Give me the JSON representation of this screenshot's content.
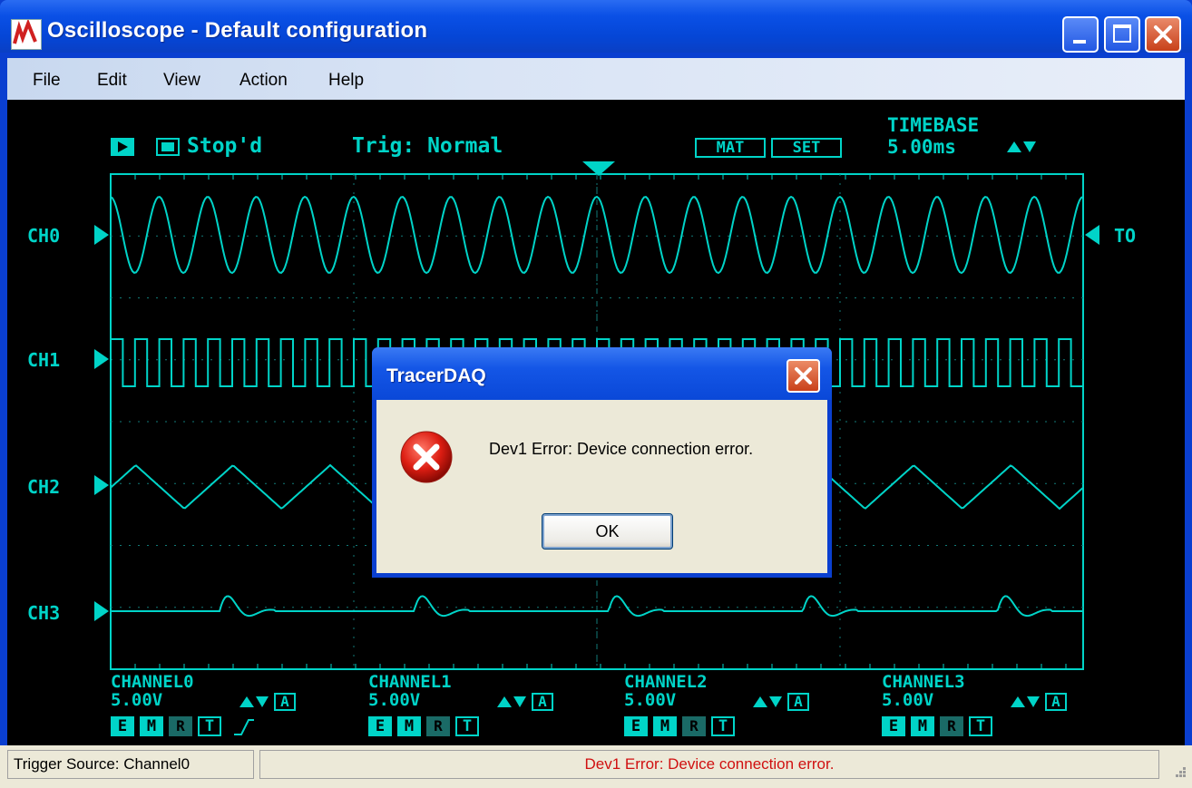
{
  "window": {
    "title": "Oscilloscope - Default configuration"
  },
  "menu": [
    "File",
    "Edit",
    "View",
    "Action",
    "Help"
  ],
  "scope": {
    "status": "Stop'd",
    "trigger": "Trig: Normal",
    "mat_label": "MAT",
    "set_label": "SET",
    "timebase_label": "TIMEBASE",
    "timebase_value": "5.00ms",
    "trigger_marker": "TO",
    "channel_markers": [
      "CH0",
      "CH1",
      "CH2",
      "CH3"
    ],
    "channels": [
      {
        "name": "CHANNEL0",
        "volts": "5.00V",
        "auto": "A",
        "flags": [
          "E",
          "M",
          "R",
          "T"
        ]
      },
      {
        "name": "CHANNEL1",
        "volts": "5.00V",
        "auto": "A",
        "flags": [
          "E",
          "M",
          "R",
          "T"
        ]
      },
      {
        "name": "CHANNEL2",
        "volts": "5.00V",
        "auto": "A",
        "flags": [
          "E",
          "M",
          "R",
          "T"
        ]
      },
      {
        "name": "CHANNEL3",
        "volts": "5.00V",
        "auto": "A",
        "flags": [
          "E",
          "M",
          "R",
          "T"
        ]
      }
    ],
    "colors": {
      "trace": "#00d4c8",
      "grid": "#127a78",
      "background": "#000000"
    }
  },
  "status_bar": {
    "trigger_source": "Trigger Source:  Channel0",
    "message": "Dev1 Error: Device connection error."
  },
  "dialog": {
    "title": "TracerDAQ",
    "message": "Dev1 Error: Device connection error.",
    "ok_label": "OK",
    "icon": "error-icon"
  }
}
